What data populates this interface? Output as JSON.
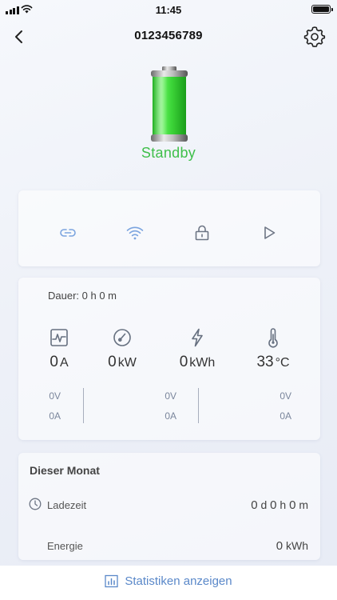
{
  "status_bar": {
    "time": "11:45"
  },
  "header": {
    "title": "0123456789"
  },
  "charger": {
    "status": "Standby",
    "status_color": "#3fbf4a"
  },
  "controls": [
    "link-icon",
    "wifi-icon",
    "lock-icon",
    "play-icon"
  ],
  "stats": {
    "duration": "Dauer: 0 h 0 m",
    "metrics": [
      {
        "icon": "pulse-icon",
        "value": "0",
        "unit": "A"
      },
      {
        "icon": "gauge-icon",
        "value": "0",
        "unit": "kW"
      },
      {
        "icon": "lightning-icon",
        "value": "0",
        "unit": "kWh"
      },
      {
        "icon": "thermometer-icon",
        "value": "33",
        "unit": "°C"
      }
    ],
    "phases": [
      {
        "voltage": "0V",
        "current": "0A"
      },
      {
        "voltage": "0V",
        "current": "0A"
      },
      {
        "voltage": "0V",
        "current": "0A"
      }
    ]
  },
  "month": {
    "title": "Dieser Monat",
    "charge_time_label": "Ladezeit",
    "charge_time": {
      "d": "0",
      "h": "0",
      "m": "0"
    },
    "energy_label": "Energie",
    "energy_value": "0",
    "energy_unit": "kWh"
  },
  "footer": {
    "stats_link": "Statistiken anzeigen"
  }
}
